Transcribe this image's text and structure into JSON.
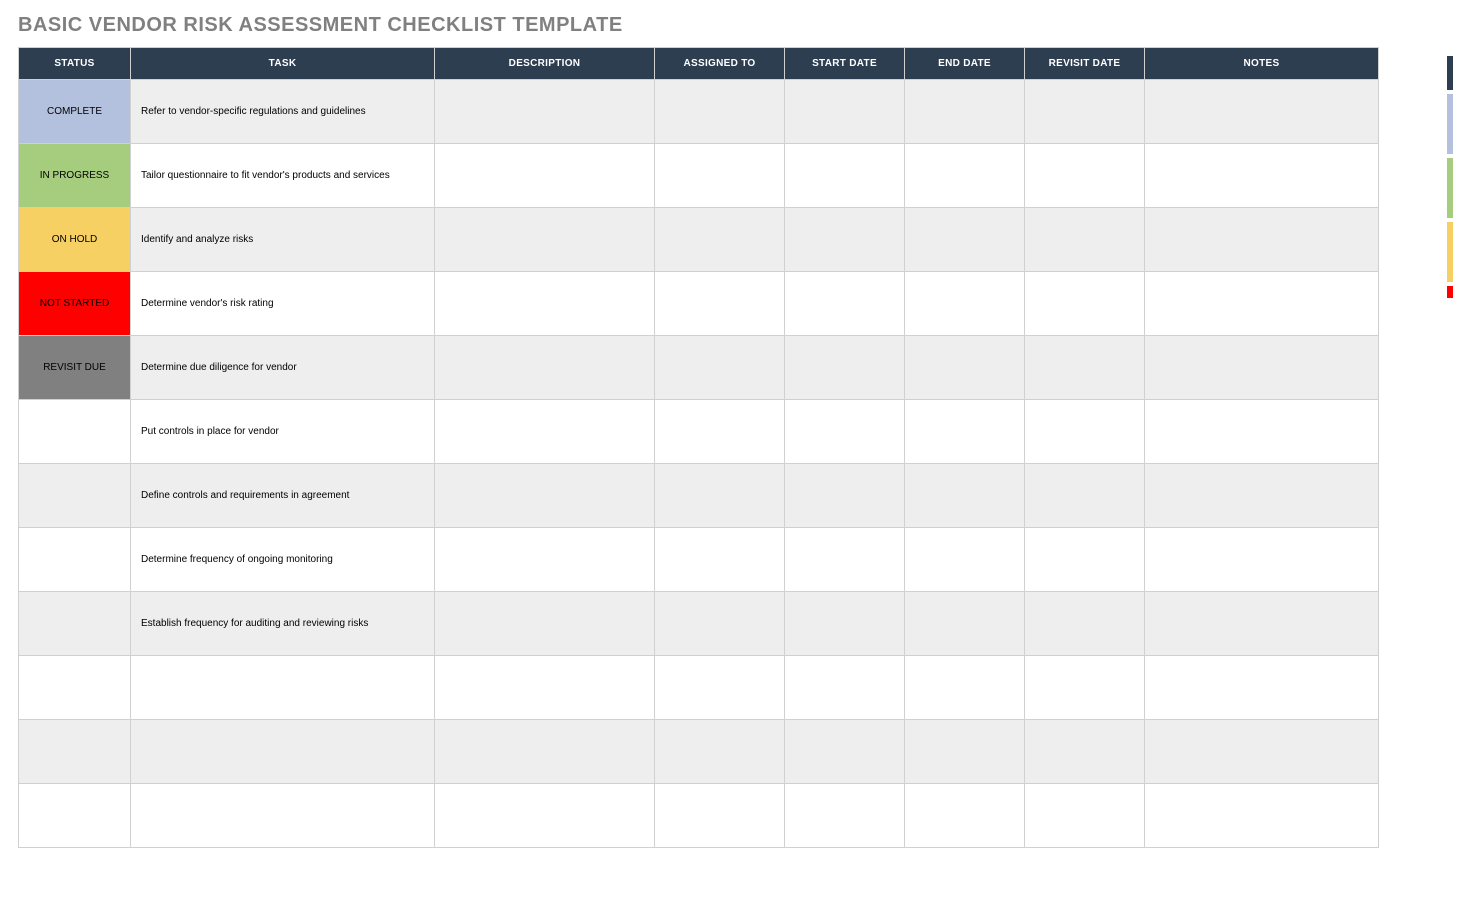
{
  "title": "BASIC VENDOR RISK ASSESSMENT CHECKLIST TEMPLATE",
  "columns": {
    "status": "STATUS",
    "task": "TASK",
    "description": "DESCRIPTION",
    "assigned": "ASSIGNED TO",
    "start": "START DATE",
    "end": "END DATE",
    "revisit": "REVISIT DATE",
    "notes": "NOTES"
  },
  "status_labels": {
    "complete": "COMPLETE",
    "in_progress": "IN PROGRESS",
    "on_hold": "ON HOLD",
    "not_started": "NOT STARTED",
    "revisit_due": "REVISIT DUE"
  },
  "rows": [
    {
      "status_key": "complete",
      "task": "Refer to vendor-specific regulations and guidelines",
      "description": "",
      "assigned": "",
      "start": "",
      "end": "",
      "revisit": "",
      "notes": ""
    },
    {
      "status_key": "in_progress",
      "task": "Tailor questionnaire to fit vendor's products and services",
      "description": "",
      "assigned": "",
      "start": "",
      "end": "",
      "revisit": "",
      "notes": ""
    },
    {
      "status_key": "on_hold",
      "task": "Identify and analyze risks",
      "description": "",
      "assigned": "",
      "start": "",
      "end": "",
      "revisit": "",
      "notes": ""
    },
    {
      "status_key": "not_started",
      "task": "Determine vendor's risk rating",
      "description": "",
      "assigned": "",
      "start": "",
      "end": "",
      "revisit": "",
      "notes": ""
    },
    {
      "status_key": "revisit_due",
      "task": "Determine due diligence for vendor",
      "description": "",
      "assigned": "",
      "start": "",
      "end": "",
      "revisit": "",
      "notes": ""
    },
    {
      "status_key": "",
      "task": "Put controls in place for vendor",
      "description": "",
      "assigned": "",
      "start": "",
      "end": "",
      "revisit": "",
      "notes": ""
    },
    {
      "status_key": "",
      "task": "Define controls and requirements in agreement",
      "description": "",
      "assigned": "",
      "start": "",
      "end": "",
      "revisit": "",
      "notes": ""
    },
    {
      "status_key": "",
      "task": "Determine frequency of ongoing monitoring",
      "description": "",
      "assigned": "",
      "start": "",
      "end": "",
      "revisit": "",
      "notes": ""
    },
    {
      "status_key": "",
      "task": "Establish frequency for auditing and reviewing risks",
      "description": "",
      "assigned": "",
      "start": "",
      "end": "",
      "revisit": "",
      "notes": ""
    },
    {
      "status_key": "",
      "task": "",
      "description": "",
      "assigned": "",
      "start": "",
      "end": "",
      "revisit": "",
      "notes": ""
    },
    {
      "status_key": "",
      "task": "",
      "description": "",
      "assigned": "",
      "start": "",
      "end": "",
      "revisit": "",
      "notes": ""
    },
    {
      "status_key": "",
      "task": "",
      "description": "",
      "assigned": "",
      "start": "",
      "end": "",
      "revisit": "",
      "notes": ""
    }
  ],
  "status_style_map": {
    "complete": "st-complete",
    "in_progress": "st-progress",
    "on_hold": "st-hold",
    "not_started": "st-notstart",
    "revisit_due": "st-revisit"
  },
  "col_widths": {
    "status": 112,
    "task": 304,
    "description": 220,
    "assigned": 130,
    "start": 120,
    "end": 120,
    "revisit": 120,
    "notes": 234
  }
}
